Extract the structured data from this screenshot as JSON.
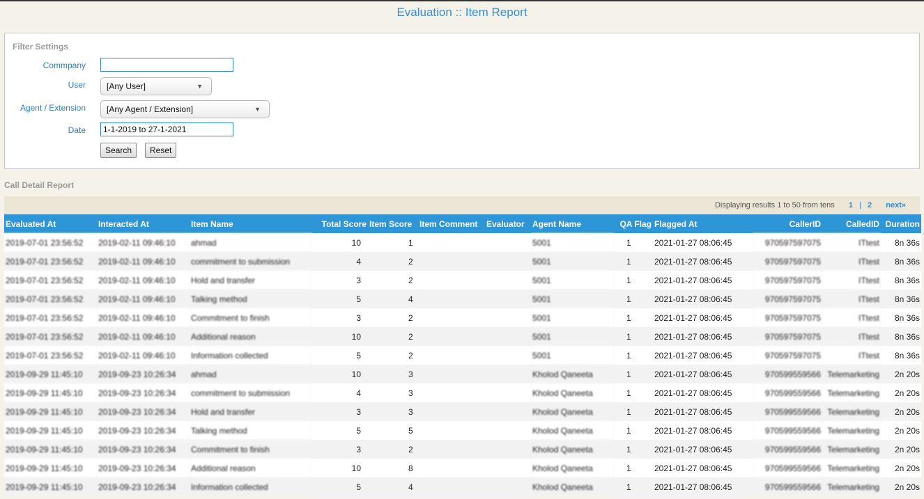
{
  "page": {
    "title": "Evaluation :: Item Report"
  },
  "filter": {
    "title": "Filter Settings",
    "company_label": "Commpany",
    "company_value": "",
    "user_label": "User",
    "user_value": "[Any User]",
    "agent_label": "Agent / Extension",
    "agent_value": "[Any Agent / Extension]",
    "date_label": "Date",
    "date_value": "1-1-2019 to 27-1-2021",
    "search_label": "Search",
    "reset_label": "Reset"
  },
  "report": {
    "title": "Call Detail Report",
    "pager": {
      "summary": "Displaying results 1 to 50 from tens",
      "pages": [
        "1",
        "2"
      ],
      "sep": "|",
      "next": "next»"
    },
    "columns": [
      "Evaluated At",
      "Interacted At",
      "Item Name",
      "Total Score",
      "Item Score",
      "Item Comment",
      "Evaluator",
      "Agent Name",
      "QA Flag",
      "Flagged At",
      "CallerID",
      "CalledID",
      "Duration"
    ],
    "rows": [
      [
        "2019-07-01 23:56:52",
        "2019-02-11 09:46:10",
        "ahmad",
        "10",
        "1",
        "",
        "",
        "5001",
        "1",
        "2021-01-27 08:06:45",
        "970597597075",
        "ITtest",
        "8n 36s"
      ],
      [
        "2019-07-01 23:56:52",
        "2019-02-11 09:46:10",
        "commitment to submission",
        "4",
        "2",
        "",
        "",
        "5001",
        "1",
        "2021-01-27 08:06:45",
        "970597597075",
        "ITtest",
        "8n 36s"
      ],
      [
        "2019-07-01 23:56:52",
        "2019-02-11 09:46:10",
        "Hold and transfer",
        "3",
        "2",
        "",
        "",
        "5001",
        "1",
        "2021-01-27 08:06:45",
        "970597597075",
        "ITtest",
        "8n 36s"
      ],
      [
        "2019-07-01 23:56:52",
        "2019-02-11 09:46:10",
        "Talking method",
        "5",
        "4",
        "",
        "",
        "5001",
        "1",
        "2021-01-27 08:06:45",
        "970597597075",
        "ITtest",
        "8n 36s"
      ],
      [
        "2019-07-01 23:56:52",
        "2019-02-11 09:46:10",
        "Commitment to finish",
        "3",
        "2",
        "",
        "",
        "5001",
        "1",
        "2021-01-27 08:06:45",
        "970597597075",
        "ITtest",
        "8n 36s"
      ],
      [
        "2019-07-01 23:56:52",
        "2019-02-11 09:46:10",
        "Additional reason",
        "10",
        "2",
        "",
        "",
        "5001",
        "1",
        "2021-01-27 08:06:45",
        "970597597075",
        "ITtest",
        "8n 36s"
      ],
      [
        "2019-07-01 23:56:52",
        "2019-02-11 09:46:10",
        "Information collected",
        "5",
        "2",
        "",
        "",
        "5001",
        "1",
        "2021-01-27 08:06:45",
        "970597597075",
        "ITtest",
        "8n 36s"
      ],
      [
        "2019-09-29 11:45:10",
        "2019-09-23 10:26:34",
        "ahmad",
        "10",
        "3",
        "",
        "",
        "Kholod Qaneeta",
        "1",
        "2021-01-27 08:06:45",
        "970599559566",
        "Telemarketing",
        "2n 20s"
      ],
      [
        "2019-09-29 11:45:10",
        "2019-09-23 10:26:34",
        "commitment to submission",
        "4",
        "3",
        "",
        "",
        "Kholod Qaneeta",
        "1",
        "2021-01-27 08:06:45",
        "970599559566",
        "Telemarketing",
        "2n 20s"
      ],
      [
        "2019-09-29 11:45:10",
        "2019-09-23 10:26:34",
        "Hold and transfer",
        "3",
        "3",
        "",
        "",
        "Kholod Qaneeta",
        "1",
        "2021-01-27 08:06:45",
        "970599559566",
        "Telemarketing",
        "2n 20s"
      ],
      [
        "2019-09-29 11:45:10",
        "2019-09-23 10:26:34",
        "Talking method",
        "5",
        "5",
        "",
        "",
        "Kholod Qaneeta",
        "1",
        "2021-01-27 08:06:45",
        "970599559566",
        "Telemarketing",
        "2n 20s"
      ],
      [
        "2019-09-29 11:45:10",
        "2019-09-23 10:26:34",
        "Commitment to finish",
        "3",
        "2",
        "",
        "",
        "Kholod Qaneeta",
        "1",
        "2021-01-27 08:06:45",
        "970599559566",
        "Telemarketing",
        "2n 20s"
      ],
      [
        "2019-09-29 11:45:10",
        "2019-09-23 10:26:34",
        "Additional reason",
        "10",
        "8",
        "",
        "",
        "Kholod Qaneeta",
        "1",
        "2021-01-27 08:06:45",
        "970599559566",
        "Telemarketing",
        "2n 20s"
      ],
      [
        "2019-09-29 11:45:10",
        "2019-09-23 10:26:34",
        "Information collected",
        "5",
        "4",
        "",
        "",
        "Kholod Qaneeta",
        "1",
        "2021-01-27 08:06:45",
        "970599559566",
        "Telemarketing",
        "2n 20s"
      ]
    ]
  },
  "colors": {
    "header_bg": "#2e95d6",
    "title": "#3a8fd0",
    "label": "#2e7fc2",
    "pager_bg": "#ebe6d6"
  }
}
